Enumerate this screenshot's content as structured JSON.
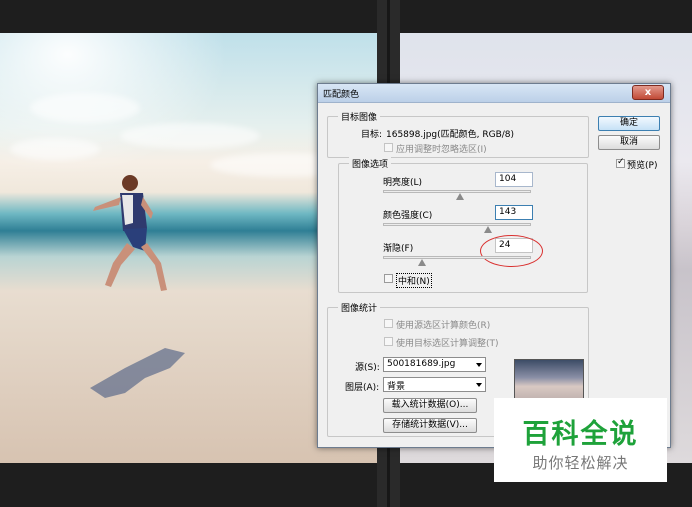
{
  "dialog": {
    "title": "匹配颜色",
    "close_label": "x",
    "target_group": {
      "title": "目标图像",
      "target_label": "目标:",
      "target_value": "165898.jpg(匹配颜色, RGB/8)",
      "ignore_selection_label": "应用调整时忽略选区(I)"
    },
    "options_group": {
      "title": "图像选项",
      "luminance_label": "明亮度(L)",
      "luminance_value": "104",
      "intensity_label": "颜色强度(C)",
      "intensity_value": "143",
      "fade_label": "渐隐(F)",
      "fade_value": "24",
      "neutralize_label": "中和(N)"
    },
    "stats_group": {
      "title": "图像统计",
      "use_selection_source_label": "使用源选区计算颜色(R)",
      "use_selection_target_label": "使用目标选区计算调整(T)",
      "source_label": "源(S):",
      "source_value": "500181689.jpg",
      "layer_label": "图层(A):",
      "layer_value": "背景",
      "load_stats_label": "载入统计数据(O)...",
      "save_stats_label": "存储统计数据(V)..."
    },
    "ok_label": "确定",
    "cancel_label": "取消",
    "preview_label": "预览(P)"
  },
  "watermark": {
    "title": "百科全说",
    "subtitle": "助你轻松解决"
  },
  "colors": {
    "accent_circle": "#d9302f",
    "watermark_green": "#1ea23a"
  }
}
